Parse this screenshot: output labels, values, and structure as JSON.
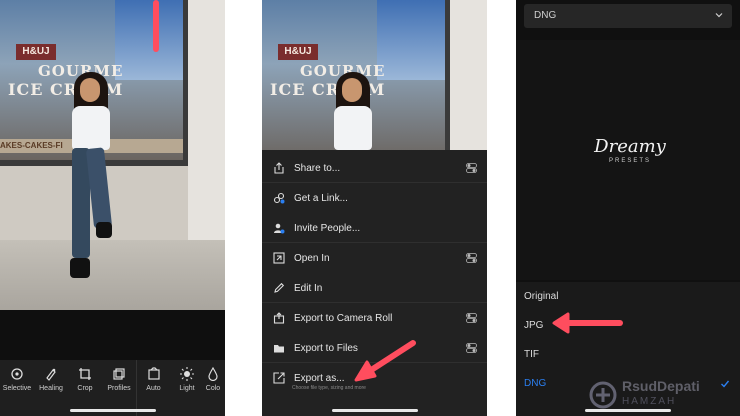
{
  "phone1": {
    "photo_signs": {
      "sign_a": "H&UJ",
      "sign_b": "GOURME",
      "sign_c": "ICE CREAM",
      "sign_d": "AKES-CAKES-FI"
    },
    "toolbar": [
      {
        "label": "Selective",
        "icon": "selective-icon"
      },
      {
        "label": "Healing",
        "icon": "healing-icon"
      },
      {
        "label": "Crop",
        "icon": "crop-icon"
      },
      {
        "label": "Profiles",
        "icon": "profiles-icon"
      },
      {
        "label": "Auto",
        "icon": "auto-icon"
      },
      {
        "label": "Light",
        "icon": "light-icon"
      },
      {
        "label": "Colo",
        "icon": "color-icon"
      }
    ]
  },
  "phone2": {
    "menu": [
      {
        "label": "Share to...",
        "icon": "share-icon",
        "toggle": true
      },
      {
        "label": "Get a Link...",
        "icon": "link-icon",
        "toggle": false
      },
      {
        "label": "Invite People...",
        "icon": "people-icon",
        "toggle": false
      },
      {
        "label": "Open In",
        "icon": "open-in-icon",
        "toggle": true
      },
      {
        "label": "Edit In",
        "icon": "edit-in-icon",
        "toggle": false
      },
      {
        "label": "Export to Camera Roll",
        "icon": "camera-roll-icon",
        "toggle": true
      },
      {
        "label": "Export to Files",
        "icon": "folder-icon",
        "toggle": true
      },
      {
        "label": "Export as...",
        "icon": "export-icon",
        "toggle": false
      }
    ],
    "export_subtitle": "Choose file type, sizing and more"
  },
  "phone3": {
    "format_select_value": "DNG",
    "logo_text": "Dreamy",
    "logo_sub": "PRESETS",
    "options": [
      {
        "label": "Original",
        "selected": false
      },
      {
        "label": "JPG",
        "selected": false
      },
      {
        "label": "TIF",
        "selected": false
      },
      {
        "label": "DNG",
        "selected": true
      }
    ],
    "accent_color": "#2b7ff0"
  },
  "watermark": {
    "main": "RsudDepati",
    "sub": "HAMZAH"
  },
  "arrow_color": "#ff4d5e"
}
